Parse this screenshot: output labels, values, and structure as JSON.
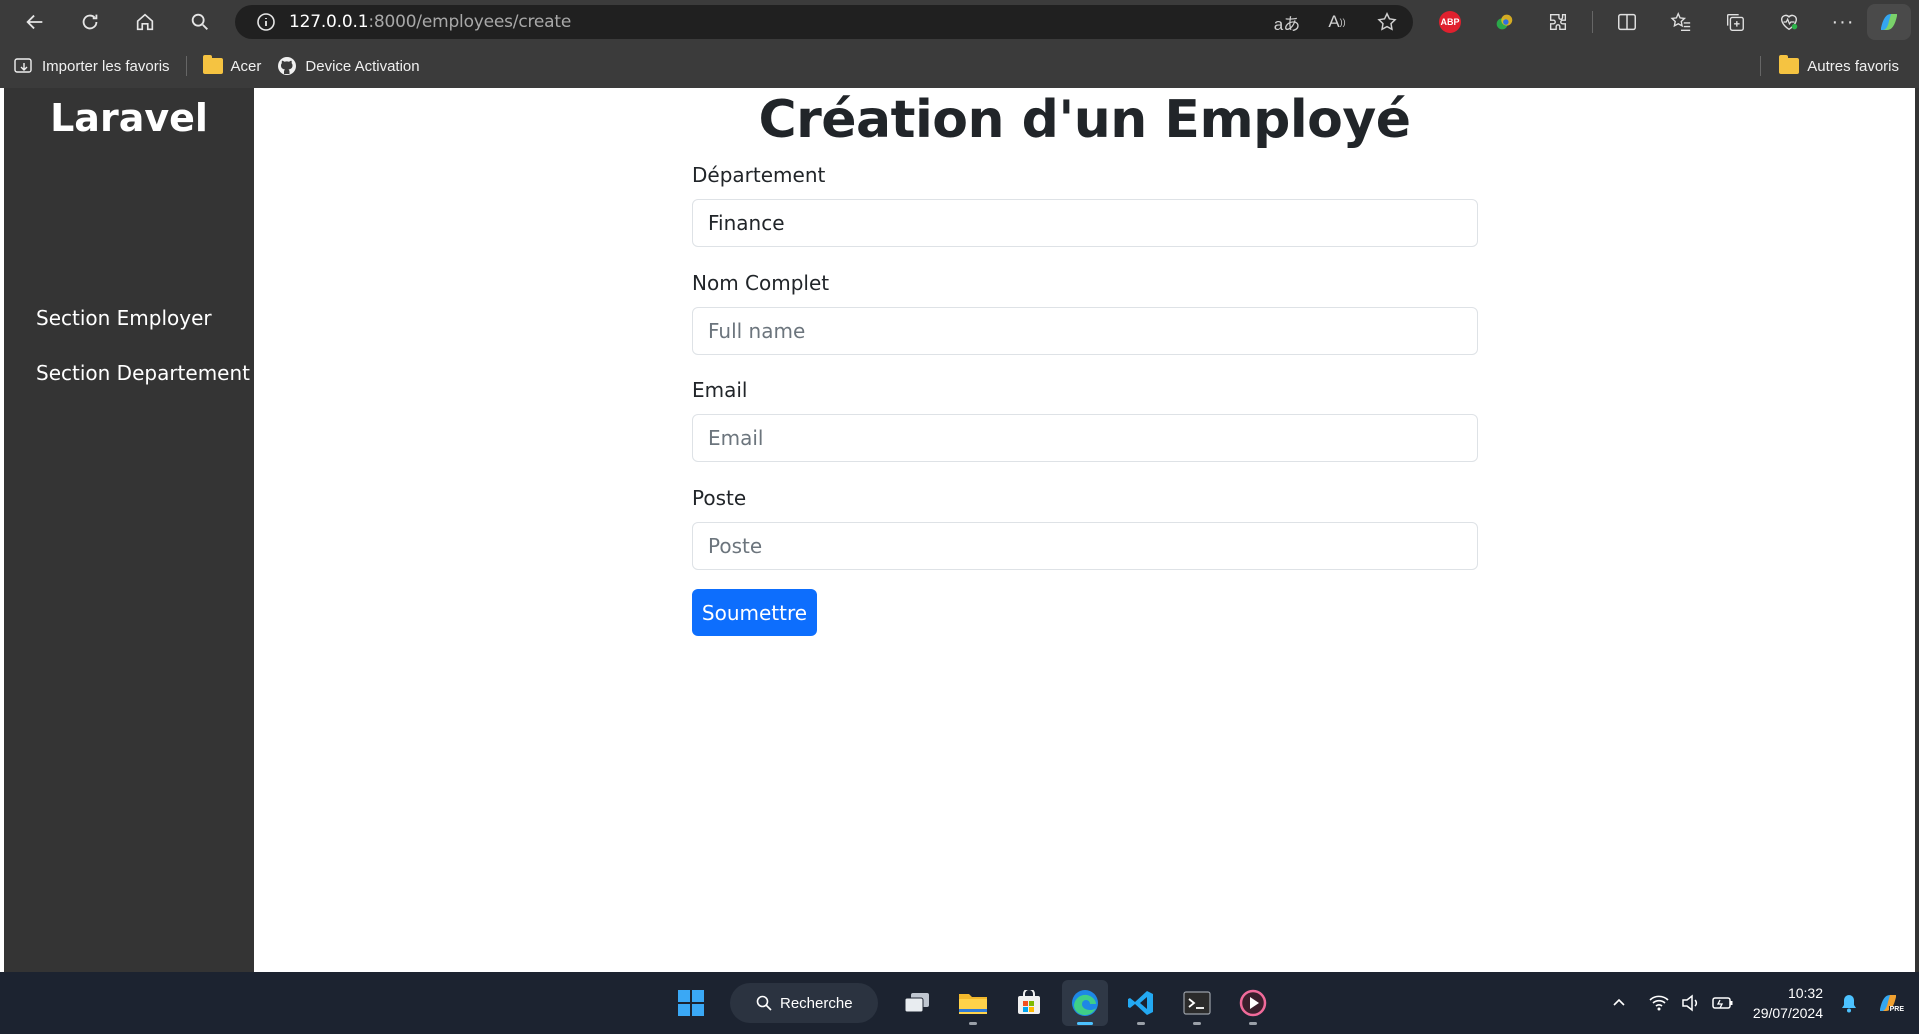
{
  "browser": {
    "url_host": "127.0.0.1",
    "url_rest": ":8000/employees/create",
    "bookmarks": [
      {
        "label": "Importer les favoris"
      },
      {
        "label": "Acer"
      },
      {
        "label": "Device Activation"
      }
    ],
    "other_bookmarks": "Autres favoris",
    "abp_badge": "ABP"
  },
  "sidebar": {
    "brand": "Laravel",
    "links": [
      {
        "label": "Section Employer"
      },
      {
        "label": "Section Departement"
      }
    ]
  },
  "form": {
    "title": "Création d'un Employé",
    "department": {
      "label": "Département",
      "value": "Finance"
    },
    "full_name": {
      "label": "Nom Complet",
      "placeholder": "Full name"
    },
    "email": {
      "label": "Email",
      "placeholder": "Email"
    },
    "position": {
      "label": "Poste",
      "placeholder": "Poste"
    },
    "submit_label": "Soumettre"
  },
  "taskbar": {
    "search_label": "Recherche",
    "time": "10:32",
    "date": "29/07/2024",
    "pre_badge": "PRE"
  },
  "colors": {
    "primary": "#0d6efd",
    "sidebar_bg": "#343434",
    "chrome_bg": "#3b3b3b",
    "taskbar_bg": "#1c2330"
  }
}
